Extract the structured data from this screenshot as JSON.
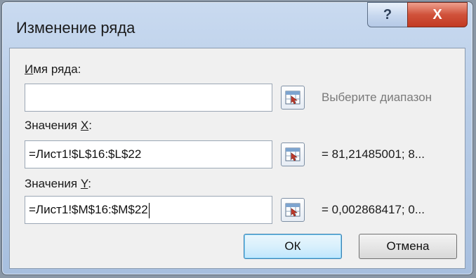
{
  "window": {
    "title": "Изменение ряда",
    "help_glyph": "?",
    "close_glyph": "X"
  },
  "series_name": {
    "label_underlined": "И",
    "label_rest": "мя ряда:",
    "value": "",
    "hint": "Выберите диапазон"
  },
  "x_values": {
    "label_prefix": "Значения ",
    "label_underlined": "X",
    "label_suffix": ":",
    "value": "=Лист1!$L$16:$L$22",
    "preview": "= 81,21485001; 8..."
  },
  "y_values": {
    "label_prefix": "Значения ",
    "label_underlined": "Y",
    "label_suffix": ":",
    "value": "=Лист1!$M$16:$M$22",
    "preview": "= 0,002868417; 0..."
  },
  "buttons": {
    "ok": "ОК",
    "cancel": "Отмена"
  },
  "icons": {
    "range_picker": "range-select-icon",
    "help": "help-icon",
    "close": "close-icon"
  },
  "colors": {
    "title_bar": "#b6cbe6",
    "close_button": "#c23a22",
    "ok_button_border": "#3c7fb1"
  }
}
